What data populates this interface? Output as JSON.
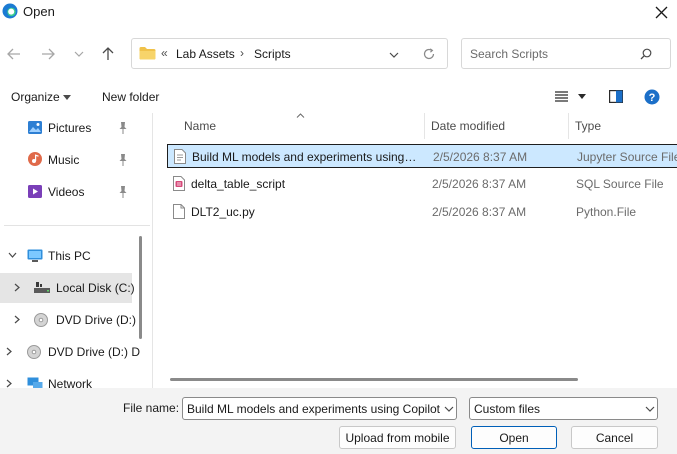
{
  "window": {
    "title": "Open"
  },
  "address": {
    "overflow": "«",
    "crumbs": [
      "Lab Assets",
      "Scripts"
    ]
  },
  "search": {
    "placeholder": "Search Scripts"
  },
  "toolbar": {
    "organize": "Organize",
    "new_folder": "New folder"
  },
  "nav": {
    "items": [
      {
        "label": "Pictures",
        "icon": "pictures-icon",
        "pinned": true
      },
      {
        "label": "Music",
        "icon": "music-icon",
        "pinned": true
      },
      {
        "label": "Videos",
        "icon": "videos-icon",
        "pinned": true
      },
      {
        "label": "This PC",
        "icon": "pc-icon"
      },
      {
        "label": "Local Disk (C:)",
        "icon": "disk-icon",
        "selected": true
      },
      {
        "label": "DVD Drive (D:)",
        "icon": "dvd-icon"
      },
      {
        "label": "DVD Drive (D:) D",
        "icon": "dvd-icon"
      },
      {
        "label": "Network",
        "icon": "network-icon"
      }
    ]
  },
  "columns": {
    "name": "Name",
    "date": "Date modified",
    "type": "Type"
  },
  "files": [
    {
      "name": "Build ML models and experiments using ...",
      "date": "2/5/2026 8:37 AM",
      "type": "Jupyter Source File",
      "icon": "notebook-file-icon",
      "selected": true
    },
    {
      "name": "delta_table_script",
      "date": "2/5/2026 8:37 AM",
      "type": "SQL Source File",
      "icon": "sql-file-icon"
    },
    {
      "name": "DLT2_uc.py",
      "date": "2/5/2026 8:37 AM",
      "type": "Python.File",
      "icon": "python-file-icon"
    }
  ],
  "bottom": {
    "filename_label": "File name:",
    "filename_value": "Build ML models and experiments using Copilot",
    "filetype_value": "Custom files",
    "upload_label": "Upload from mobile",
    "open_label": "Open",
    "cancel_label": "Cancel"
  },
  "colors": {
    "accent": "#005fb8",
    "selection": "#cce8ff",
    "folder": "#f0c24a"
  }
}
